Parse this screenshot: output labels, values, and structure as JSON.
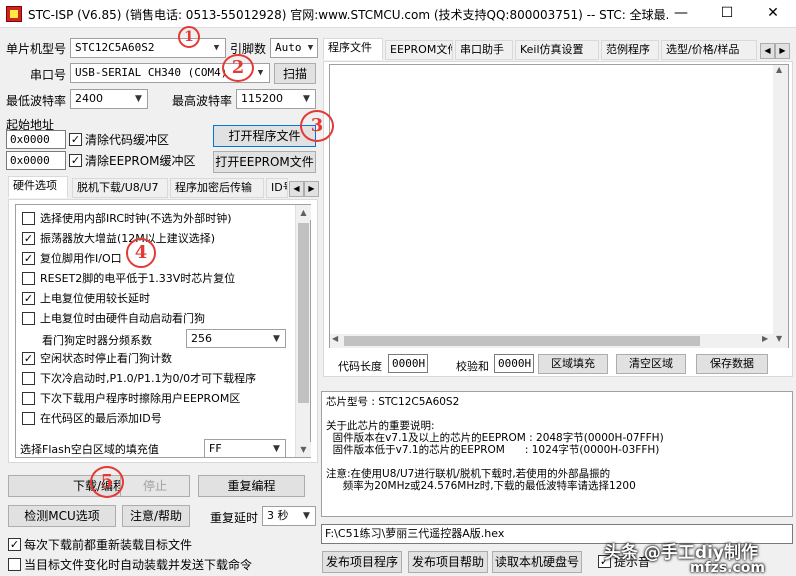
{
  "window": {
    "title": "STC-ISP (V6.85) (销售电话: 0513-55012928) 官网:www.STCMCU.com  (技术支持QQ:800003751)  -- STC: 全球最...",
    "minimize": "—",
    "maximize": "☐",
    "close": "✕"
  },
  "left": {
    "mcu_label": "单片机型号",
    "mcu_value": "STC12C5A60S2",
    "pins_label": "引脚数",
    "pins_value": "Auto",
    "port_label": "串口号",
    "port_value": "USB-SERIAL CH340 (COM4)",
    "scan_btn": "扫描",
    "min_baud_label": "最低波特率",
    "min_baud_value": "2400",
    "max_baud_label": "最高波特率",
    "max_baud_value": "115200",
    "start_addr_label": "起始地址",
    "addr1_value": "0x0000",
    "clear_code_label": "清除代码缓冲区",
    "open_prog_btn": "打开程序文件",
    "addr2_value": "0x0000",
    "clear_eeprom_label": "清除EEPROM缓冲区",
    "open_eeprom_btn": "打开EEPROM文件",
    "tabs": [
      "硬件选项",
      "脱机下载/U8/U7",
      "程序加密后传输",
      "ID号"
    ],
    "hw_options": [
      {
        "label": "选择使用内部IRC时钟(不选为外部时钟)",
        "checked": false
      },
      {
        "label": "振荡器放大增益(12M以上建议选择)",
        "checked": true
      },
      {
        "label": "复位脚用作I/O口",
        "checked": true
      },
      {
        "label": "RESET2脚的电平低于1.33V时芯片复位",
        "checked": false
      },
      {
        "label": "上电复位使用较长延时",
        "checked": true
      },
      {
        "label": "上电复位时由硬件自动启动看门狗",
        "checked": false
      }
    ],
    "wdt_label": "看门狗定时器分频系数",
    "wdt_value": "256",
    "hw_options2": [
      {
        "label": "空闲状态时停止看门狗计数",
        "checked": true
      },
      {
        "label": "下次冷启动时,P1.0/P1.1为0/0才可下载程序",
        "checked": false
      },
      {
        "label": "下次下载用户程序时擦除用户EEPROM区",
        "checked": false
      },
      {
        "label": "在代码区的最后添加ID号",
        "checked": false
      }
    ],
    "fill_label": "选择Flash空白区域的填充值",
    "fill_value": "FF",
    "download_btn": "下载/编程",
    "stop_btn": "停止",
    "reprogram_btn": "重复编程",
    "check_mcu_btn": "检测MCU选项",
    "help_btn": "注意/帮助",
    "delay_label": "重复延时",
    "delay_value": "3 秒",
    "reload_label": "每次下载前都重新装载目标文件",
    "reload_checked": true,
    "auto_label": "当目标文件变化时自动装载并发送下载命令",
    "auto_checked": false
  },
  "right": {
    "tabs": [
      "程序文件",
      "EEPROM文件",
      "串口助手",
      "Keil仿真设置",
      "范例程序",
      "选型/价格/样品"
    ],
    "code_len_label": "代码长度",
    "code_len_value": "0000H",
    "checksum_label": "校验和",
    "checksum_value": "0000H",
    "fill_area_btn": "区域填充",
    "clear_area_btn": "清空区域",
    "save_data_btn": "保存数据",
    "info_lines": [
      "芯片型号 : STC12C5A60S2",
      "",
      "关于此芯片的重要说明:",
      "  固件版本在v7.1及以上的芯片的EEPROM : 2048字节(0000H-07FFH)",
      "  固件版本低于v7.1的芯片的EEPROM      : 1024字节(0000H-03FFH)",
      "",
      "注意:在使用U8/U7进行联机/脱机下载时,若使用的外部晶振的",
      "     频率为20MHz或24.576MHz时,下载的最低波特率请选择1200"
    ],
    "file_path": "F:\\C51练习\\萝丽三代遥控器A版.hex",
    "publish_prog_btn": "发布项目程序",
    "publish_help_btn": "发布项目帮助",
    "read_serial_btn": "读取本机硬盘号",
    "prompt_label": "提示音",
    "prompt_checked": true
  },
  "annotations": [
    "1",
    "2",
    "3",
    "4",
    "5"
  ],
  "watermark": {
    "text": "头条 @手工diy制作",
    "site": "mfzs.com"
  },
  "colors": {
    "annotation": "#e53935",
    "accent": "#0078d7"
  }
}
